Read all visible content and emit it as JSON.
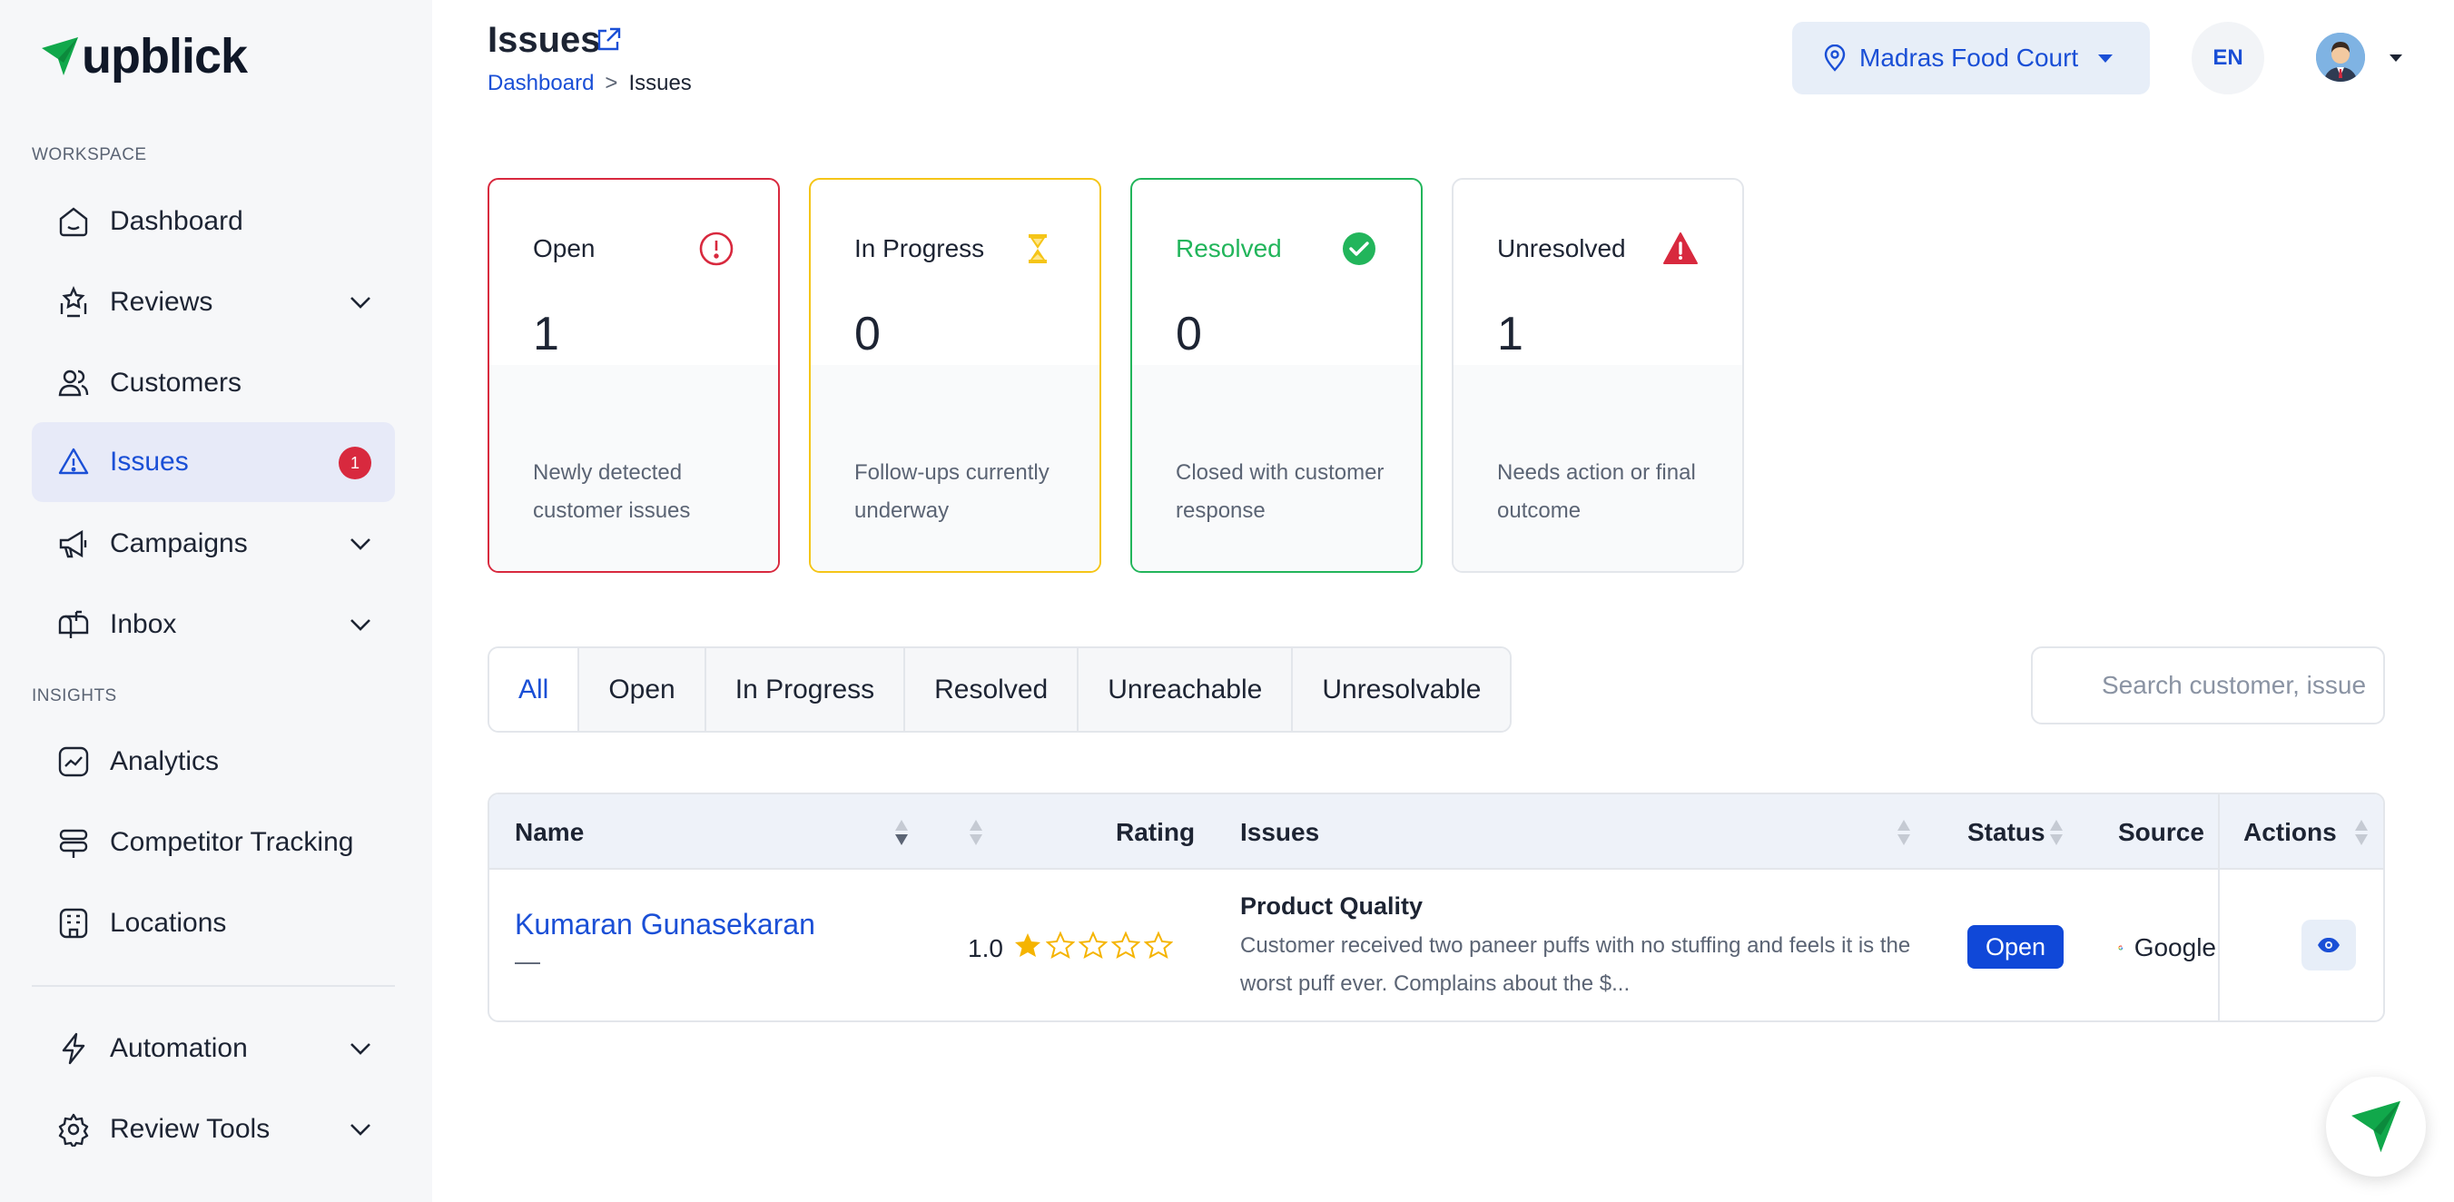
{
  "brand": {
    "name": "upblick",
    "accent": "#1a4fd6",
    "logo_green": "#11a84b"
  },
  "sidebar": {
    "workspace_label": "WORKSPACE",
    "insights_label": "INSIGHTS",
    "items": [
      {
        "label": "Dashboard",
        "icon": "home-icon"
      },
      {
        "label": "Reviews",
        "icon": "reviews-icon",
        "expandable": true
      },
      {
        "label": "Customers",
        "icon": "users-icon"
      },
      {
        "label": "Issues",
        "icon": "warning-icon",
        "active": true,
        "badge": "1"
      },
      {
        "label": "Campaigns",
        "icon": "megaphone-icon",
        "expandable": true
      },
      {
        "label": "Inbox",
        "icon": "mailbox-icon",
        "expandable": true
      },
      {
        "label": "Analytics",
        "icon": "analytics-icon"
      },
      {
        "label": "Competitor Tracking",
        "icon": "signpost-icon"
      },
      {
        "label": "Locations",
        "icon": "building-icon"
      },
      {
        "label": "Automation",
        "icon": "bolt-icon",
        "expandable": true
      },
      {
        "label": "Review Tools",
        "icon": "gear-icon",
        "expandable": true
      }
    ]
  },
  "header": {
    "title": "Issues",
    "breadcrumb": {
      "home": "Dashboard",
      "sep": ">",
      "current": "Issues"
    },
    "location": "Madras Food Court",
    "language": "EN"
  },
  "cards": [
    {
      "title": "Open",
      "value": "1",
      "desc": "Newly detected customer issues",
      "color": "#d8293e",
      "icon": "alert-circle-icon"
    },
    {
      "title": "In Progress",
      "value": "0",
      "desc": "Follow-ups currently underway",
      "color": "#f5c518",
      "icon": "hourglass-icon"
    },
    {
      "title": "Resolved",
      "value": "0",
      "desc": "Closed with customer response",
      "color": "#22b55b",
      "icon": "check-circle-icon"
    },
    {
      "title": "Unresolved",
      "value": "1",
      "desc": "Needs action or final outcome",
      "color": "#e3e6eb",
      "icon": "warning-triangle-icon"
    }
  ],
  "tabs": [
    "All",
    "Open",
    "In Progress",
    "Resolved",
    "Unreachable",
    "Unresolvable"
  ],
  "search": {
    "placeholder": "Search customer, issue"
  },
  "table": {
    "headers": {
      "name": "Name",
      "rating": "Rating",
      "issues": "Issues",
      "status": "Status",
      "source": "Source",
      "actions": "Actions"
    },
    "rows": [
      {
        "name": "Kumaran Gunasekaran",
        "sub": "—",
        "rating": "1.0",
        "stars_filled": 1,
        "stars_total": 5,
        "issue_title": "Product Quality",
        "issue_desc": "Customer received two paneer puffs with no stuffing and feels it is the worst puff ever. Complains about the $...",
        "status": "Open",
        "source": "Google"
      }
    ]
  }
}
